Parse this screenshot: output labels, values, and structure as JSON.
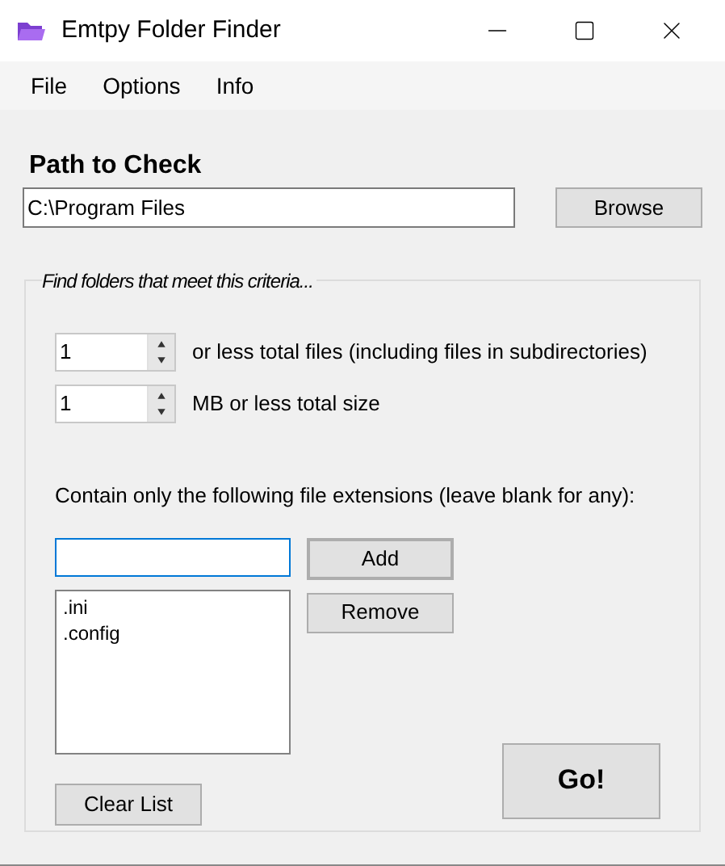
{
  "window": {
    "title": "Emtpy Folder Finder"
  },
  "menu": [
    "File",
    "Options",
    "Info"
  ],
  "path": {
    "label": "Path to Check",
    "value": "C:\\Program Files",
    "browse": "Browse"
  },
  "criteria": {
    "legend": "Find folders that meet this criteria...",
    "spinners": [
      {
        "value": "1",
        "label": "or less total files (including files in subdirectories)"
      },
      {
        "value": "1",
        "label": "MB or less total size"
      }
    ],
    "extensions_label": "Contain only the following file extensions (leave blank for any):",
    "add": "Add",
    "remove": "Remove",
    "extensions": [
      ".ini",
      ".config"
    ],
    "clear": "Clear List",
    "go": "Go!"
  }
}
